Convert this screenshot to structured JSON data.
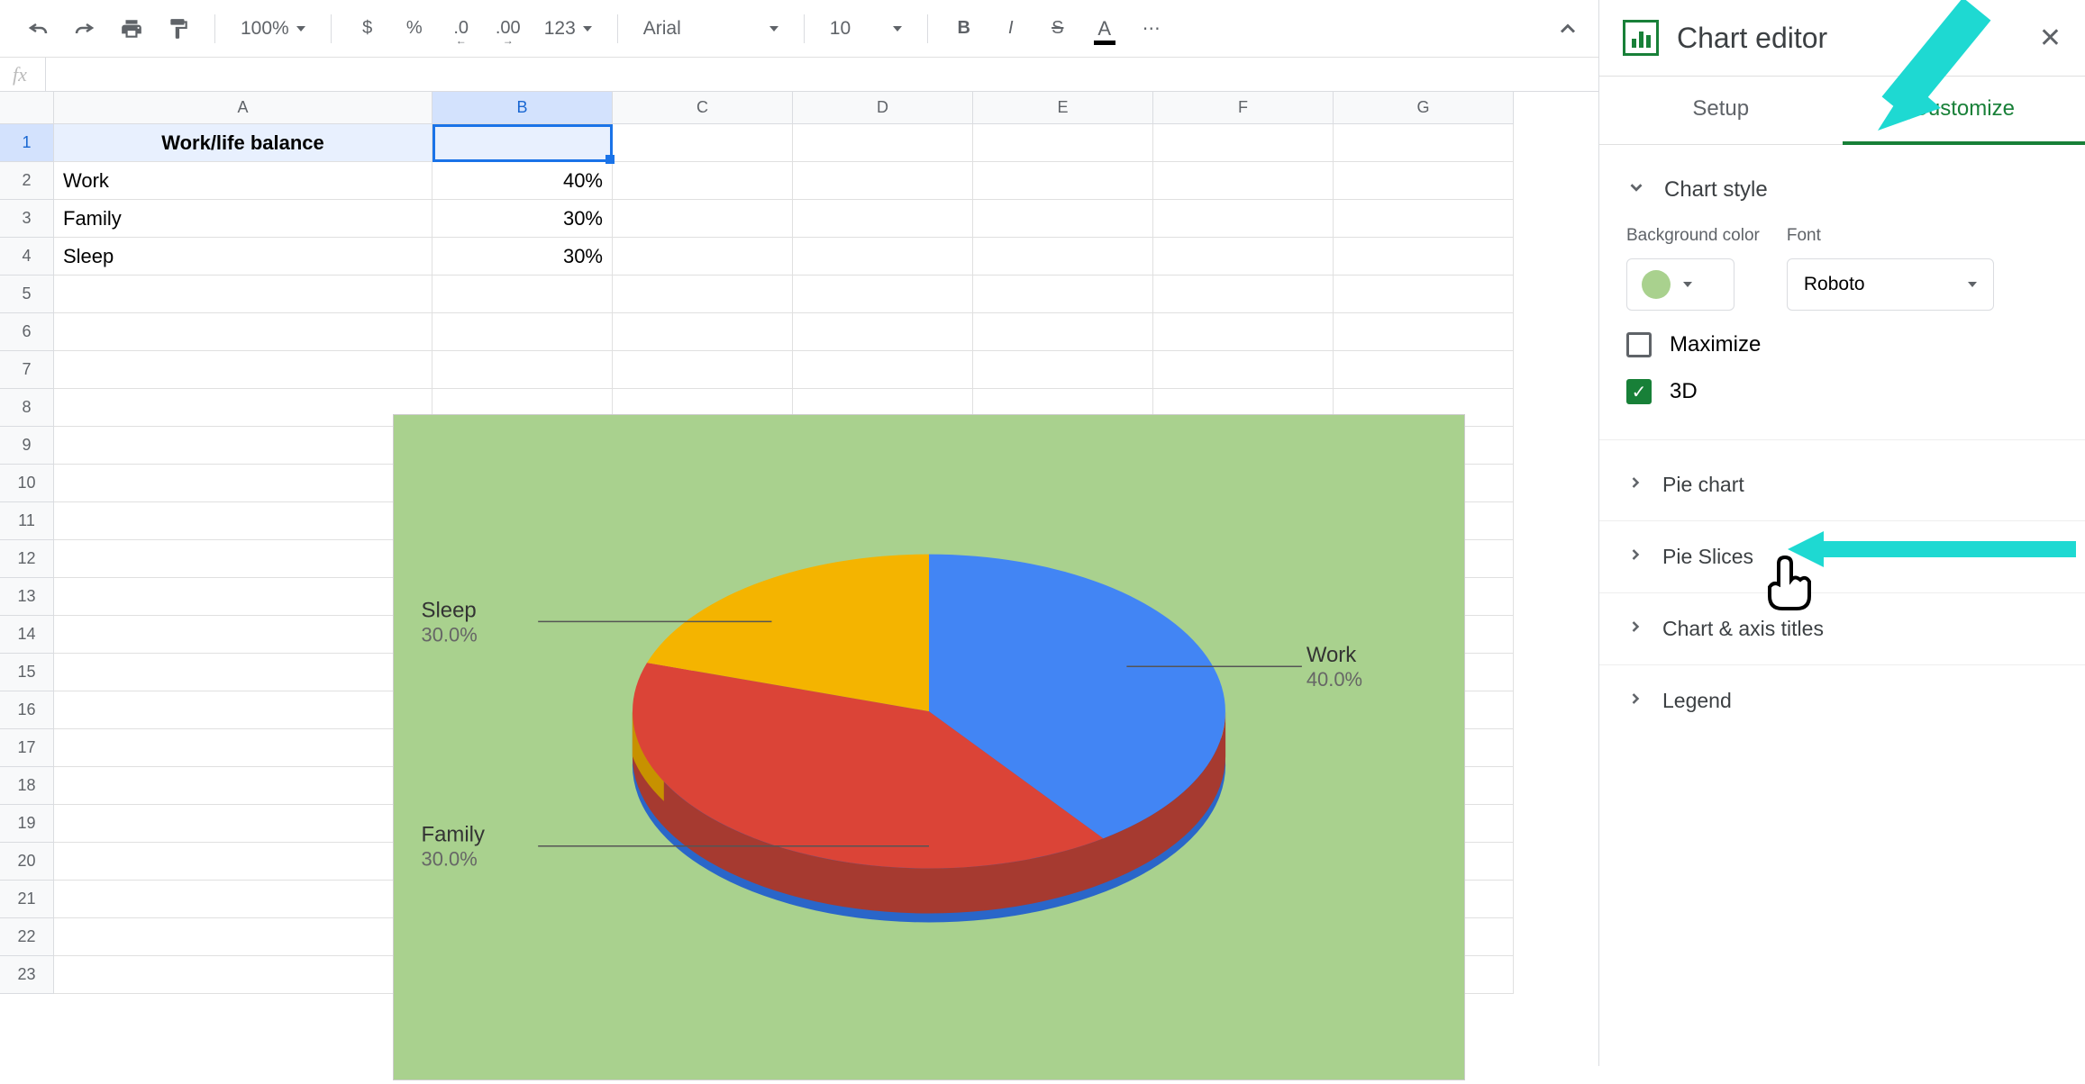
{
  "toolbar": {
    "zoom": "100%",
    "font": "Arial",
    "fontSize": "10",
    "currency": "$",
    "percent": "%",
    "decDec": ".0",
    "incDec": ".00",
    "format123": "123",
    "bold": "B",
    "italic": "I",
    "strike": "S",
    "textColor": "A",
    "more": "⋯"
  },
  "formulaLabel": "fx",
  "columns": [
    "A",
    "B",
    "C",
    "D",
    "E",
    "F",
    "G"
  ],
  "rows": [
    "1",
    "2",
    "3",
    "4",
    "5",
    "6",
    "7",
    "8",
    "9",
    "10",
    "11",
    "12",
    "13",
    "14",
    "15",
    "16",
    "17",
    "18",
    "19",
    "20",
    "21",
    "22",
    "23"
  ],
  "cells": {
    "A1": "Work/life balance",
    "A2": "Work",
    "B2": "40%",
    "A3": "Family",
    "B3": "30%",
    "A4": "Sleep",
    "B4": "30%"
  },
  "chart_data": {
    "type": "pie",
    "title": "",
    "categories": [
      "Work",
      "Family",
      "Sleep"
    ],
    "values": [
      40,
      30,
      30
    ],
    "labels": {
      "work": "Work",
      "work_pct": "40.0%",
      "family": "Family",
      "family_pct": "30.0%",
      "sleep": "Sleep",
      "sleep_pct": "30.0%"
    },
    "colors": {
      "Work": "#4285f4",
      "Family": "#db4437",
      "Sleep": "#f4b400"
    },
    "background": "#a9d18e",
    "style": "3D"
  },
  "editor": {
    "title": "Chart editor",
    "tabs": {
      "setup": "Setup",
      "customize": "Customize"
    },
    "sections": {
      "chartStyle": "Chart style",
      "bgColor": "Background color",
      "font": "Font",
      "fontValue": "Roboto",
      "maximize": "Maximize",
      "threeD": "3D",
      "pieChart": "Pie chart",
      "pieSlices": "Pie Slices",
      "chartAxis": "Chart & axis titles",
      "legend": "Legend"
    }
  }
}
